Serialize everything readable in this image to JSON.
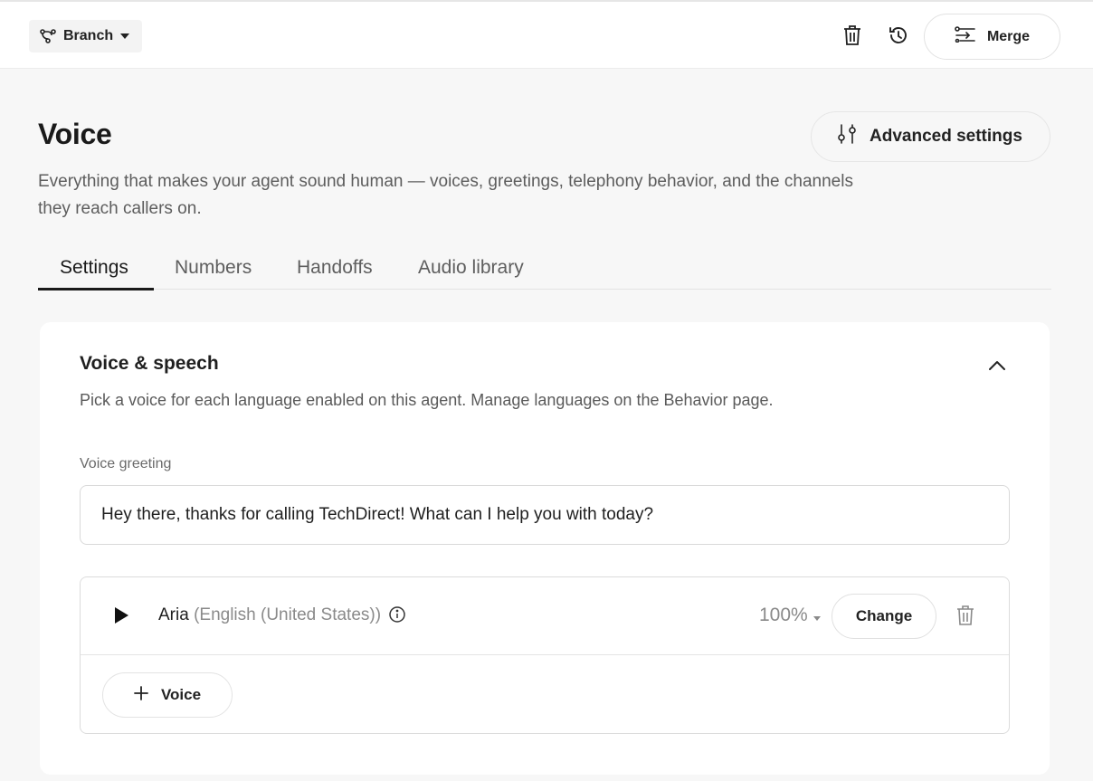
{
  "topbar": {
    "branch_label": "Branch",
    "branch_icon": "branch-icon",
    "delete_icon": "trash-icon",
    "history_icon": "history-icon",
    "merge_label": "Merge",
    "merge_icon": "merge-icon"
  },
  "header": {
    "title": "Voice",
    "description": "Everything that makes your agent sound human — voices, greetings, telephony behavior, and the channels they reach callers on.",
    "advanced_settings_label": "Advanced settings",
    "advanced_settings_icon": "sliders-icon"
  },
  "tabs": [
    {
      "label": "Settings",
      "active": true
    },
    {
      "label": "Numbers",
      "active": false
    },
    {
      "label": "Handoffs",
      "active": false
    },
    {
      "label": "Audio library",
      "active": false
    }
  ],
  "voice_speech": {
    "title": "Voice & speech",
    "description": "Pick a voice for each language enabled on this agent. Manage languages on the Behavior page.",
    "greeting_label": "Voice greeting",
    "greeting_value": "Hey there, thanks for calling TechDirect! What can I help you with today?",
    "voices": [
      {
        "name": "Aria",
        "language": "(English (United States))",
        "speed": "100%",
        "change_label": "Change"
      }
    ],
    "add_voice_label": "Voice"
  },
  "colors": {
    "background": "#f7f7f7",
    "card": "#ffffff",
    "text_primary": "#1f1f1f",
    "text_secondary": "#5d5d5d",
    "border": "#dcdcdc"
  }
}
